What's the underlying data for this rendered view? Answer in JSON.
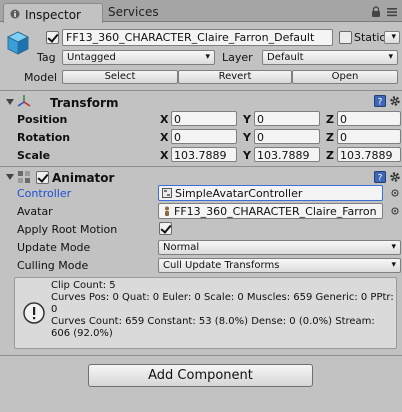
{
  "tabs": [
    {
      "label": "Inspector",
      "active": true
    },
    {
      "label": "Services",
      "active": false
    }
  ],
  "header": {
    "active": true,
    "object_name": "FF13_360_CHARACTER_Claire_Farron_Default",
    "static_label": "Static",
    "static_checked": false,
    "tag_label": "Tag",
    "tag_value": "Untagged",
    "layer_label": "Layer",
    "layer_value": "Default",
    "model_label": "Model",
    "model_buttons": [
      "Select",
      "Revert",
      "Open"
    ]
  },
  "transform": {
    "title": "Transform",
    "rows": [
      {
        "label": "Position",
        "x": "0",
        "y": "0",
        "z": "0"
      },
      {
        "label": "Rotation",
        "x": "0",
        "y": "0",
        "z": "0"
      },
      {
        "label": "Scale",
        "x": "103.7889",
        "y": "103.7889",
        "z": "103.7889"
      }
    ],
    "axis_labels": [
      "X",
      "Y",
      "Z"
    ]
  },
  "animator": {
    "title": "Animator",
    "enabled": true,
    "controller_label": "Controller",
    "controller_value": "SimpleAvatarController",
    "avatar_label": "Avatar",
    "avatar_value": "FF13_360_CHARACTER_Claire_Farron",
    "apply_root_motion_label": "Apply Root Motion",
    "apply_root_motion": true,
    "update_mode_label": "Update Mode",
    "update_mode_value": "Normal",
    "culling_mode_label": "Culling Mode",
    "culling_mode_value": "Cull Update Transforms",
    "info_lines": [
      "Clip Count: 5",
      "Curves Pos: 0 Quat: 0 Euler: 0 Scale: 0 Muscles: 659 Generic: 0 PPtr: 0",
      "Curves Count: 659 Constant: 53 (8.0%) Dense: 0 (0.0%) Stream: 606 (92.0%)"
    ]
  },
  "add_component_label": "Add Component",
  "colors": {
    "background": "#c2c2c2",
    "controller_label": "#1d4fd6",
    "selected_field_border": "#3b6fd8"
  }
}
